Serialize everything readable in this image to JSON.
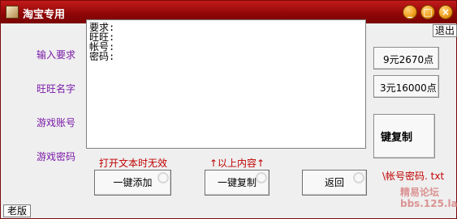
{
  "window": {
    "title": "淘宝专用"
  },
  "title_buttons": {
    "minimize": "_",
    "maximize": "□",
    "close": "×"
  },
  "exit_label": "退出",
  "old_version_label": "老版",
  "labels": {
    "requirement": "输入要求",
    "wangwang": "旺旺名字",
    "account": "游戏账号",
    "password": "游戏密码"
  },
  "textarea_lines": [
    "要求:",
    "旺旺:",
    "帐号:",
    "密码:"
  ],
  "side_buttons": {
    "price_a": "9元2670点",
    "price_b": "3元16000点",
    "copy_big": "键复制"
  },
  "hints": {
    "open_text_invalid": "打开文本时无效",
    "above_content": "↑以上内容↑",
    "file_hint": "\\帐号密码. txt"
  },
  "buttons": {
    "add": "一键添加",
    "copy": "一键复制",
    "back": "返回"
  },
  "watermark": {
    "line1": "精易论坛",
    "line2": "bbs.125.la"
  },
  "colors": {
    "title_red": "#8e0606",
    "label_purple": "#7a1aa8",
    "hint_red": "#c00000"
  }
}
